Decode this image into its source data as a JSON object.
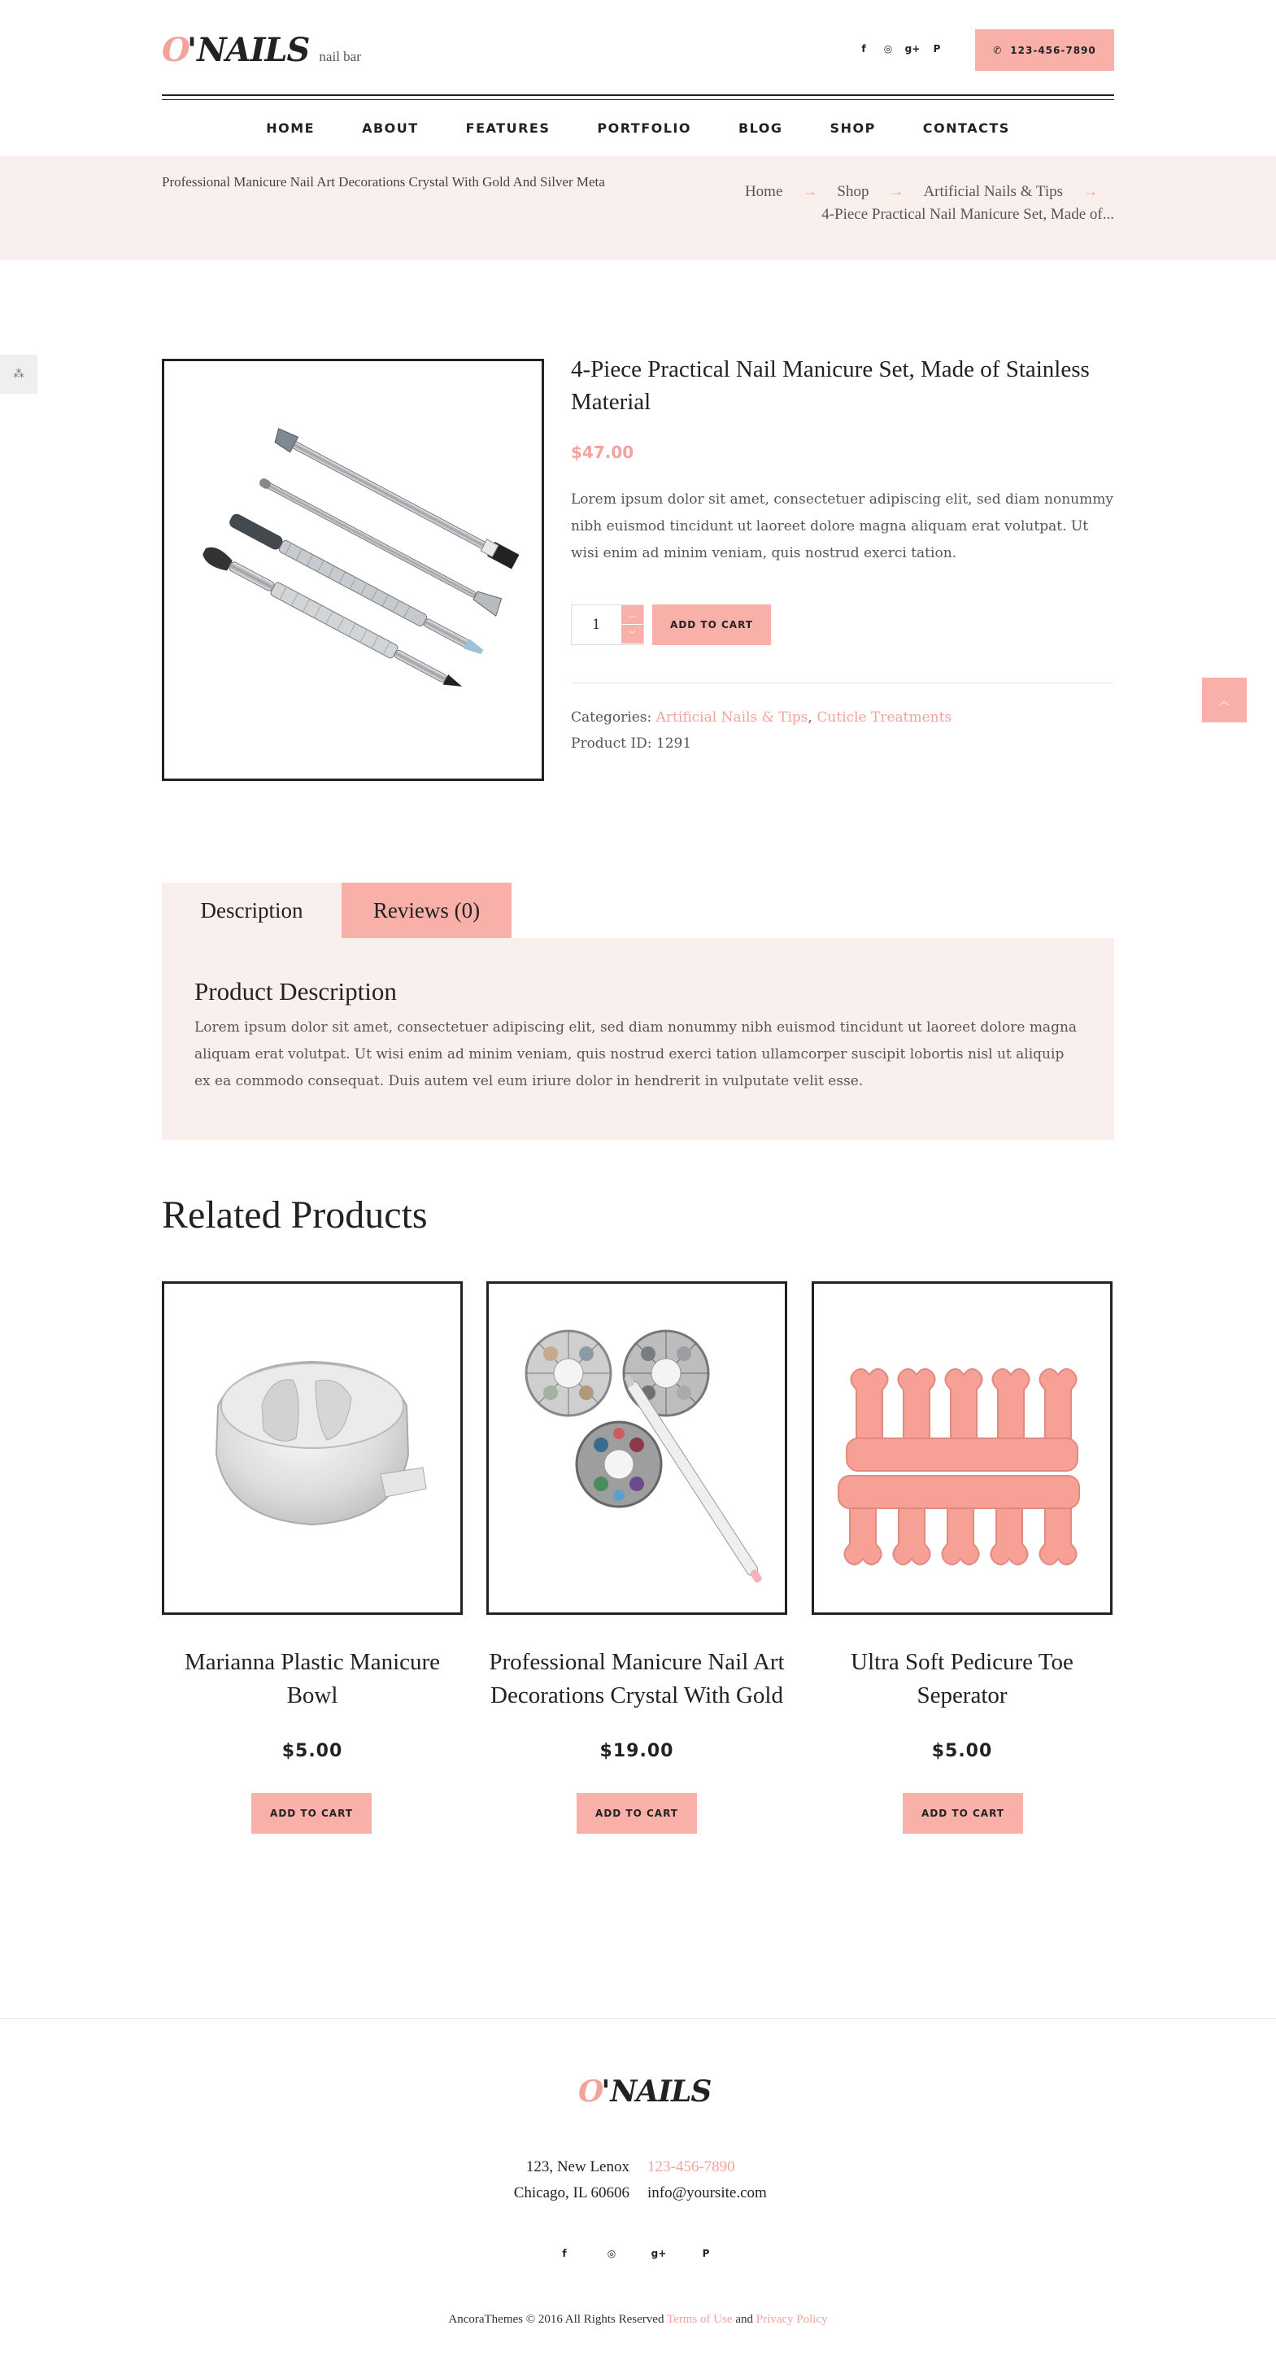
{
  "header": {
    "logo_o": "O",
    "logo_apos": "'",
    "logo_nails": "NAILS",
    "logo_tagline": "nail bar",
    "social_icons": [
      "facebook-icon",
      "instagram-icon",
      "google-plus-icon",
      "paypal-icon"
    ],
    "social_glyphs": [
      "f",
      "◎",
      "g+",
      "P"
    ],
    "phone": "123-456-7890",
    "phone_glyph": "✆"
  },
  "nav": {
    "items": [
      {
        "label": "HOME"
      },
      {
        "label": "ABOUT"
      },
      {
        "label": "FEATURES"
      },
      {
        "label": "PORTFOLIO"
      },
      {
        "label": "BLOG"
      },
      {
        "label": "SHOP"
      },
      {
        "label": "CONTACTS"
      }
    ]
  },
  "breadcrumb": {
    "page_title": "Professional Manicure Nail Art Decorations Crystal With Gold And Silver Meta",
    "items": [
      {
        "label": "Home"
      },
      {
        "label": "Shop"
      },
      {
        "label": "Artificial Nails & Tips"
      }
    ],
    "arrow": "→",
    "current": "4-Piece Practical Nail Manicure Set, Made of..."
  },
  "side_widget": {
    "glyph": "⁂"
  },
  "scroll_top": {
    "glyph": "︿"
  },
  "product": {
    "title": "4-Piece Practical Nail Manicure Set, Made of Stainless Material",
    "price": "$47.00",
    "description": "Lorem ipsum dolor sit amet, consectetuer adipiscing elit, sed diam nonummy nibh euismod tincidunt ut laoreet dolore magna aliquam erat volutpat. Ut wisi enim ad minim veniam, quis nostrud exerci tation.",
    "quantity": "1",
    "qty_up": "︿",
    "qty_down": "﹀",
    "add_to_cart": "ADD TO CART",
    "categories_label": "Categories:",
    "category_1": "Artificial Nails & Tips",
    "category_sep": ",",
    "category_2": "Cuticle Treatments",
    "product_id_label": "Product ID:",
    "product_id": "1291"
  },
  "tabs": {
    "items": [
      {
        "label": "Description"
      },
      {
        "label": "Reviews (0)"
      }
    ],
    "heading": "Product Description",
    "body": "Lorem ipsum dolor sit amet, consectetuer adipiscing elit, sed diam nonummy nibh euismod tincidunt ut laoreet dolore magna aliquam erat volutpat. Ut wisi enim ad minim veniam, quis nostrud exerci tation ullamcorper suscipit lobortis nisl ut aliquip ex ea commodo consequat. Duis autem vel eum iriure dolor in hendrerit in vulputate velit esse."
  },
  "related": {
    "title": "Related Products",
    "items": [
      {
        "name": "Marianna Plastic Manicure Bowl",
        "price": "$5.00",
        "button": "ADD TO CART"
      },
      {
        "name": "Professional Manicure Nail Art Decorations Crystal With Gold",
        "price": "$19.00",
        "button": "ADD TO CART"
      },
      {
        "name": "Ultra Soft Pedicure Toe Seperator",
        "price": "$5.00",
        "button": "ADD TO CART"
      }
    ]
  },
  "footer": {
    "logo_o": "O",
    "logo_apos": "'",
    "logo_nails": "NAILS",
    "address_line1": "123, New Lenox",
    "address_line2": "Chicago, IL 60606",
    "phone": "123-456-7890",
    "email": "info@yoursite.com",
    "social_glyphs": [
      "f",
      "◎",
      "g+",
      "P"
    ],
    "copyright": "AncoraThemes © 2016 All Rights Reserved",
    "terms": "Terms of Use",
    "and": "and",
    "privacy": "Privacy Policy"
  },
  "colors": {
    "accent": "#f9b0a8",
    "accent_text": "#f3a39b",
    "tint_bg": "#f9f0ed",
    "dark": "#222222"
  }
}
